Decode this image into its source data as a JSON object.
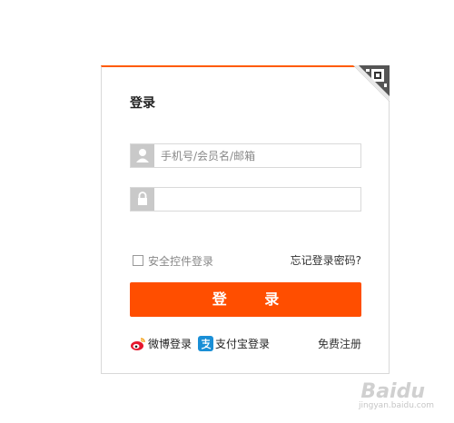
{
  "login": {
    "title": "登录",
    "username_placeholder": "手机号/会员名/邮箱",
    "password_value": "",
    "security_control_label": "安全控件登录",
    "forgot_password": "忘记登录密码?",
    "login_button": "登 录",
    "weibo_login": "微博登录",
    "alipay_login": "支付宝登录",
    "register": "免费注册"
  },
  "icons": {
    "qr": "qr-code-icon",
    "user": "user-icon",
    "lock": "lock-icon",
    "weibo": "weibo-icon",
    "alipay": "alipay-icon"
  },
  "colors": {
    "accent": "#ff4e00",
    "top_border": "#ff5a00"
  },
  "watermark": {
    "text": "Baidu",
    "sub": "jingyan.baidu.com"
  }
}
